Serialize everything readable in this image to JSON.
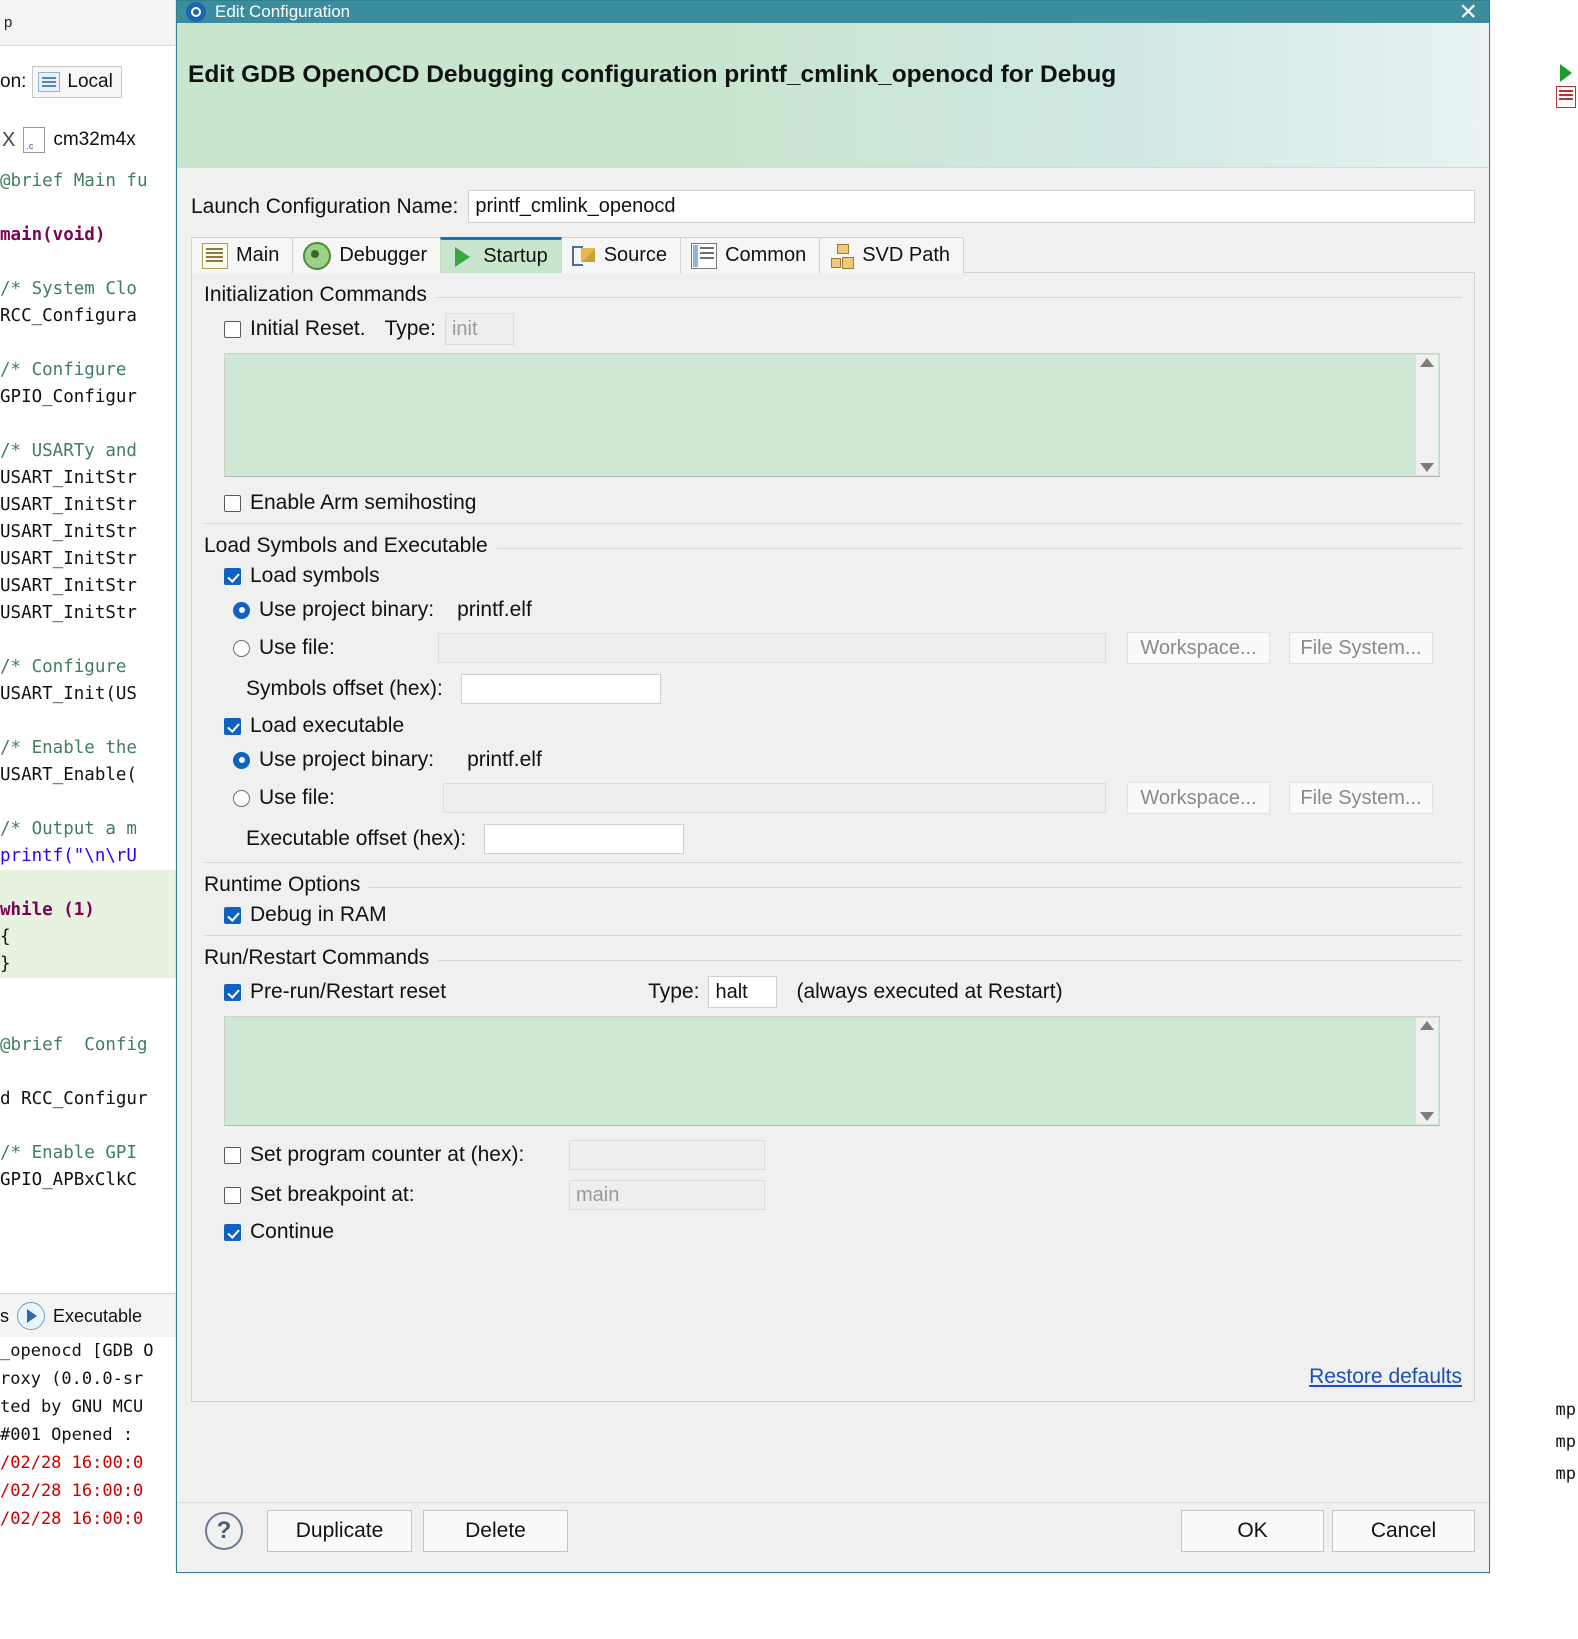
{
  "background": {
    "toolstrip_label": "p",
    "on_label": "on:",
    "local_label": "Local",
    "close_x": "X",
    "file_tab_label": "cm32m4x",
    "code_lines": [
      {
        "text": "@brief Main fu",
        "cls": "cm-comment"
      },
      {
        "text": "",
        "cls": "cm-plain"
      },
      {
        "text": "main(void)",
        "cls": "cm-kw"
      },
      {
        "text": "",
        "cls": "cm-plain"
      },
      {
        "text": "/* System Clo",
        "cls": "cm-comment"
      },
      {
        "text": "RCC_Configura",
        "cls": "cm-plain"
      },
      {
        "text": "",
        "cls": "cm-plain"
      },
      {
        "text": "/* Configure ",
        "cls": "cm-comment"
      },
      {
        "text": "GPIO_Configur",
        "cls": "cm-plain"
      },
      {
        "text": "",
        "cls": "cm-plain"
      },
      {
        "text": "/* USARTy and",
        "cls": "cm-comment"
      },
      {
        "text": "USART_InitStr",
        "cls": "cm-plain"
      },
      {
        "text": "USART_InitStr",
        "cls": "cm-plain"
      },
      {
        "text": "USART_InitStr",
        "cls": "cm-plain"
      },
      {
        "text": "USART_InitStr",
        "cls": "cm-plain"
      },
      {
        "text": "USART_InitStr",
        "cls": "cm-plain"
      },
      {
        "text": "USART_InitStr",
        "cls": "cm-plain"
      },
      {
        "text": "",
        "cls": "cm-plain"
      },
      {
        "text": "/* Configure ",
        "cls": "cm-comment"
      },
      {
        "text": "USART_Init(US",
        "cls": "cm-plain"
      },
      {
        "text": "",
        "cls": "cm-plain"
      },
      {
        "text": "/* Enable the",
        "cls": "cm-comment"
      },
      {
        "text": "USART_Enable(",
        "cls": "cm-plain"
      },
      {
        "text": "",
        "cls": "cm-plain"
      },
      {
        "text": "/* Output a m",
        "cls": "cm-comment"
      },
      {
        "text": "printf(\"\\n\\rU",
        "cls": "cm-str"
      },
      {
        "text": "",
        "cls": "cm-plain"
      },
      {
        "text": "while (1)",
        "cls": "cm-kw"
      },
      {
        "text": "{",
        "cls": "cm-plain"
      },
      {
        "text": "}",
        "cls": "cm-plain"
      },
      {
        "text": "",
        "cls": "cm-plain"
      },
      {
        "text": "",
        "cls": "cm-plain"
      },
      {
        "text": "@brief  Config",
        "cls": "cm-comment"
      },
      {
        "text": "",
        "cls": "cm-plain"
      },
      {
        "text": "d RCC_Configur",
        "cls": "cm-plain"
      },
      {
        "text": "",
        "cls": "cm-plain"
      },
      {
        "text": "/* Enable GPI",
        "cls": "cm-comment"
      },
      {
        "text": "GPIO_APBxClkC",
        "cls": "cm-plain"
      }
    ],
    "console_tab_label": "Executable",
    "console_tabs_prefix": "s",
    "console_lines": [
      {
        "text": "_openocd [GDB O",
        "err": false
      },
      {
        "text": "roxy (0.0.0-sr",
        "err": false
      },
      {
        "text": "ted by GNU MCU",
        "err": false
      },
      {
        "text": " #001 Opened :",
        "err": false
      },
      {
        "text": "/02/28 16:00:0",
        "err": true
      },
      {
        "text": "/02/28 16:00:0",
        "err": true
      },
      {
        "text": "/02/28 16:00:0",
        "err": true
      }
    ],
    "right_labels": [
      "mp",
      "mp",
      "mp"
    ]
  },
  "dialog": {
    "window_title": "Edit Configuration",
    "close_label": "×",
    "banner_title": "Edit GDB OpenOCD Debugging configuration printf_cmlink_openocd for Debug",
    "launch_config": {
      "label": "Launch Configuration Name:",
      "value": "printf_cmlink_openocd"
    },
    "tabs": [
      {
        "label": "Main",
        "icon": "document-icon",
        "active": false
      },
      {
        "label": "Debugger",
        "icon": "bug-icon",
        "active": false
      },
      {
        "label": "Startup",
        "icon": "play-icon",
        "active": true
      },
      {
        "label": "Source",
        "icon": "source-edit-icon",
        "active": false
      },
      {
        "label": "Common",
        "icon": "table-icon",
        "active": false
      },
      {
        "label": "SVD Path",
        "icon": "tree-icon",
        "active": false
      }
    ],
    "initialization": {
      "group_title": "Initialization Commands",
      "initial_reset_label": "Initial Reset.",
      "initial_reset_checked": false,
      "type_label": "Type:",
      "type_value": "init",
      "type_is_placeholder": true,
      "commands_text": "",
      "semihosting_label": "Enable Arm semihosting",
      "semihosting_checked": false
    },
    "load_section": {
      "group_title": "Load Symbols and Executable",
      "load_symbols_label": "Load symbols",
      "load_symbols_checked": true,
      "symbols_project_binary_label": "Use project binary:",
      "symbols_project_binary_value": "printf.elf",
      "symbols_project_binary_selected": true,
      "symbols_use_file_label": "Use file:",
      "symbols_use_file_selected": false,
      "symbols_use_file_value": "",
      "symbols_workspace_button": "Workspace...",
      "symbols_filesystem_button": "File System...",
      "symbols_offset_label": "Symbols offset (hex):",
      "symbols_offset_value": "",
      "load_executable_label": "Load executable",
      "load_executable_checked": true,
      "exec_project_binary_label": "Use project binary:",
      "exec_project_binary_value": "printf.elf",
      "exec_project_binary_selected": true,
      "exec_use_file_label": "Use file:",
      "exec_use_file_selected": false,
      "exec_use_file_value": "",
      "exec_workspace_button": "Workspace...",
      "exec_filesystem_button": "File System...",
      "exec_offset_label": "Executable offset (hex):",
      "exec_offset_value": ""
    },
    "runtime": {
      "group_title": "Runtime Options",
      "debug_in_ram_label": "Debug in RAM",
      "debug_in_ram_checked": true
    },
    "run_restart": {
      "group_title": "Run/Restart Commands",
      "prerun_label": "Pre-run/Restart reset",
      "prerun_checked": true,
      "type_label": "Type:",
      "type_value": "halt",
      "note": "(always executed at Restart)",
      "commands_text": "",
      "set_pc_label": "Set program counter at (hex):",
      "set_pc_checked": false,
      "set_pc_value": "",
      "set_breakpoint_label": "Set breakpoint at:",
      "set_breakpoint_checked": false,
      "set_breakpoint_value": "main",
      "continue_label": "Continue",
      "continue_checked": true
    },
    "restore_defaults_link": "Restore defaults",
    "footer": {
      "help_label": "?",
      "duplicate_label": "Duplicate",
      "delete_label": "Delete",
      "ok_label": "OK",
      "cancel_label": "Cancel"
    }
  },
  "colors": {
    "titlebar": "#3b8d9e",
    "banner_green": "#c8e6cd",
    "accent_blue": "#0f62c4",
    "link_blue": "#1a4fb4",
    "command_area": "#cfe8d4"
  }
}
